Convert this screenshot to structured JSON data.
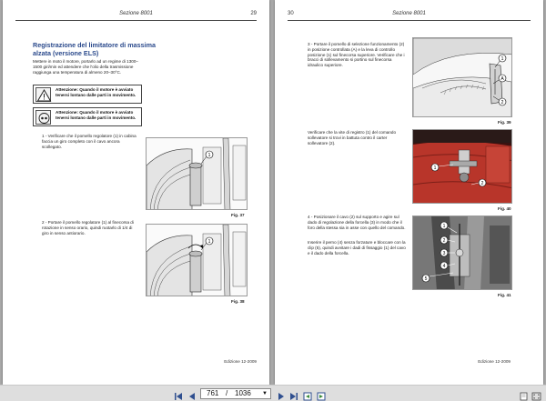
{
  "left_page": {
    "section": "Sezione 8001",
    "page_number": "29",
    "title": "Registrazione del limitatore di massima alzata (versione ELS)",
    "intro": "Mettere in moto il motore, portarlo ad un regime di 1300–1500 giri/min ed attendere che l'olio della trasmissione raggiunga una temperatura di almeno 20–30°C.",
    "warning_1": "Attenzione: Quando il motore è avviato tenersi lontano dalle parti in movimento.",
    "warning_2": "Attenzione: Quando il motore è avviato tenersi lontano dalle parti in movimento.",
    "step_1": "1 - Verificare che il pomello regolatore (1) in cabina faccia un giro completo con il cavo ancora scollegato.",
    "step_2": "2 - Portare il pomello regolatore (1) al finecorsa di rotazione in senso orario, quindi ruotarlo di 1/4 di giro in senso antiorario.",
    "fig_37_caption": "Fig. 37",
    "fig_38_caption": "Fig. 38",
    "fig_37_label": "1",
    "fig_38_label": "1",
    "footer": "Edizione 12-2009"
  },
  "right_page": {
    "section": "Sezione 8001",
    "page_number": "30",
    "step_3": "3 - Portare il pomello di selezione funzionamento (2) in posizione controllata (A) e la leva di controllo posizione (1) sul finecorsa superiore. Verificare che i bracci di sollevamento si portino sul finecorsa idraulico superiore.",
    "check_text": "Verificare che la vite di registro (1) del comando sollevatore si trovi in battuta contro il carter sollevatore (2).",
    "step_4a": "4 - Posizionare il cavo (2) sul supporto e agire sul dado di regolazione della forcella (3) in modo che il foro della stessa sia in asse con quello del comando.",
    "step_4b": "Inserire il perno (4) senza forzature e bloccare con la clip (5), quindi avvitare i dadi di fissaggio (1) del cavo e il dado della forcella.",
    "fig_39_caption": "Fig. 39",
    "fig_40_caption": "Fig. 40",
    "fig_41_caption": "Fig. 41",
    "fig_39_labels": [
      "1",
      "A",
      "2"
    ],
    "fig_40_labels": [
      "1",
      "2"
    ],
    "fig_41_labels": [
      "1",
      "2",
      "3",
      "4",
      "5"
    ],
    "footer": "Edizione 12-2009"
  },
  "toolbar": {
    "current_page": "761",
    "separator": "/",
    "total_pages": "1036"
  },
  "colors": {
    "title_blue": "#2b4a8c",
    "viewer_background": "#a9a9a9",
    "toolbar_background": "#dedede",
    "nav_icon_blue": "#2f4f8f",
    "engine_red": "#b8352a"
  },
  "icons": [
    "first-page-icon",
    "previous-page-icon",
    "page-dropdown-icon",
    "next-page-icon",
    "last-page-icon",
    "back-view-icon",
    "forward-view-icon",
    "single-page-icon",
    "fullscreen-icon"
  ]
}
